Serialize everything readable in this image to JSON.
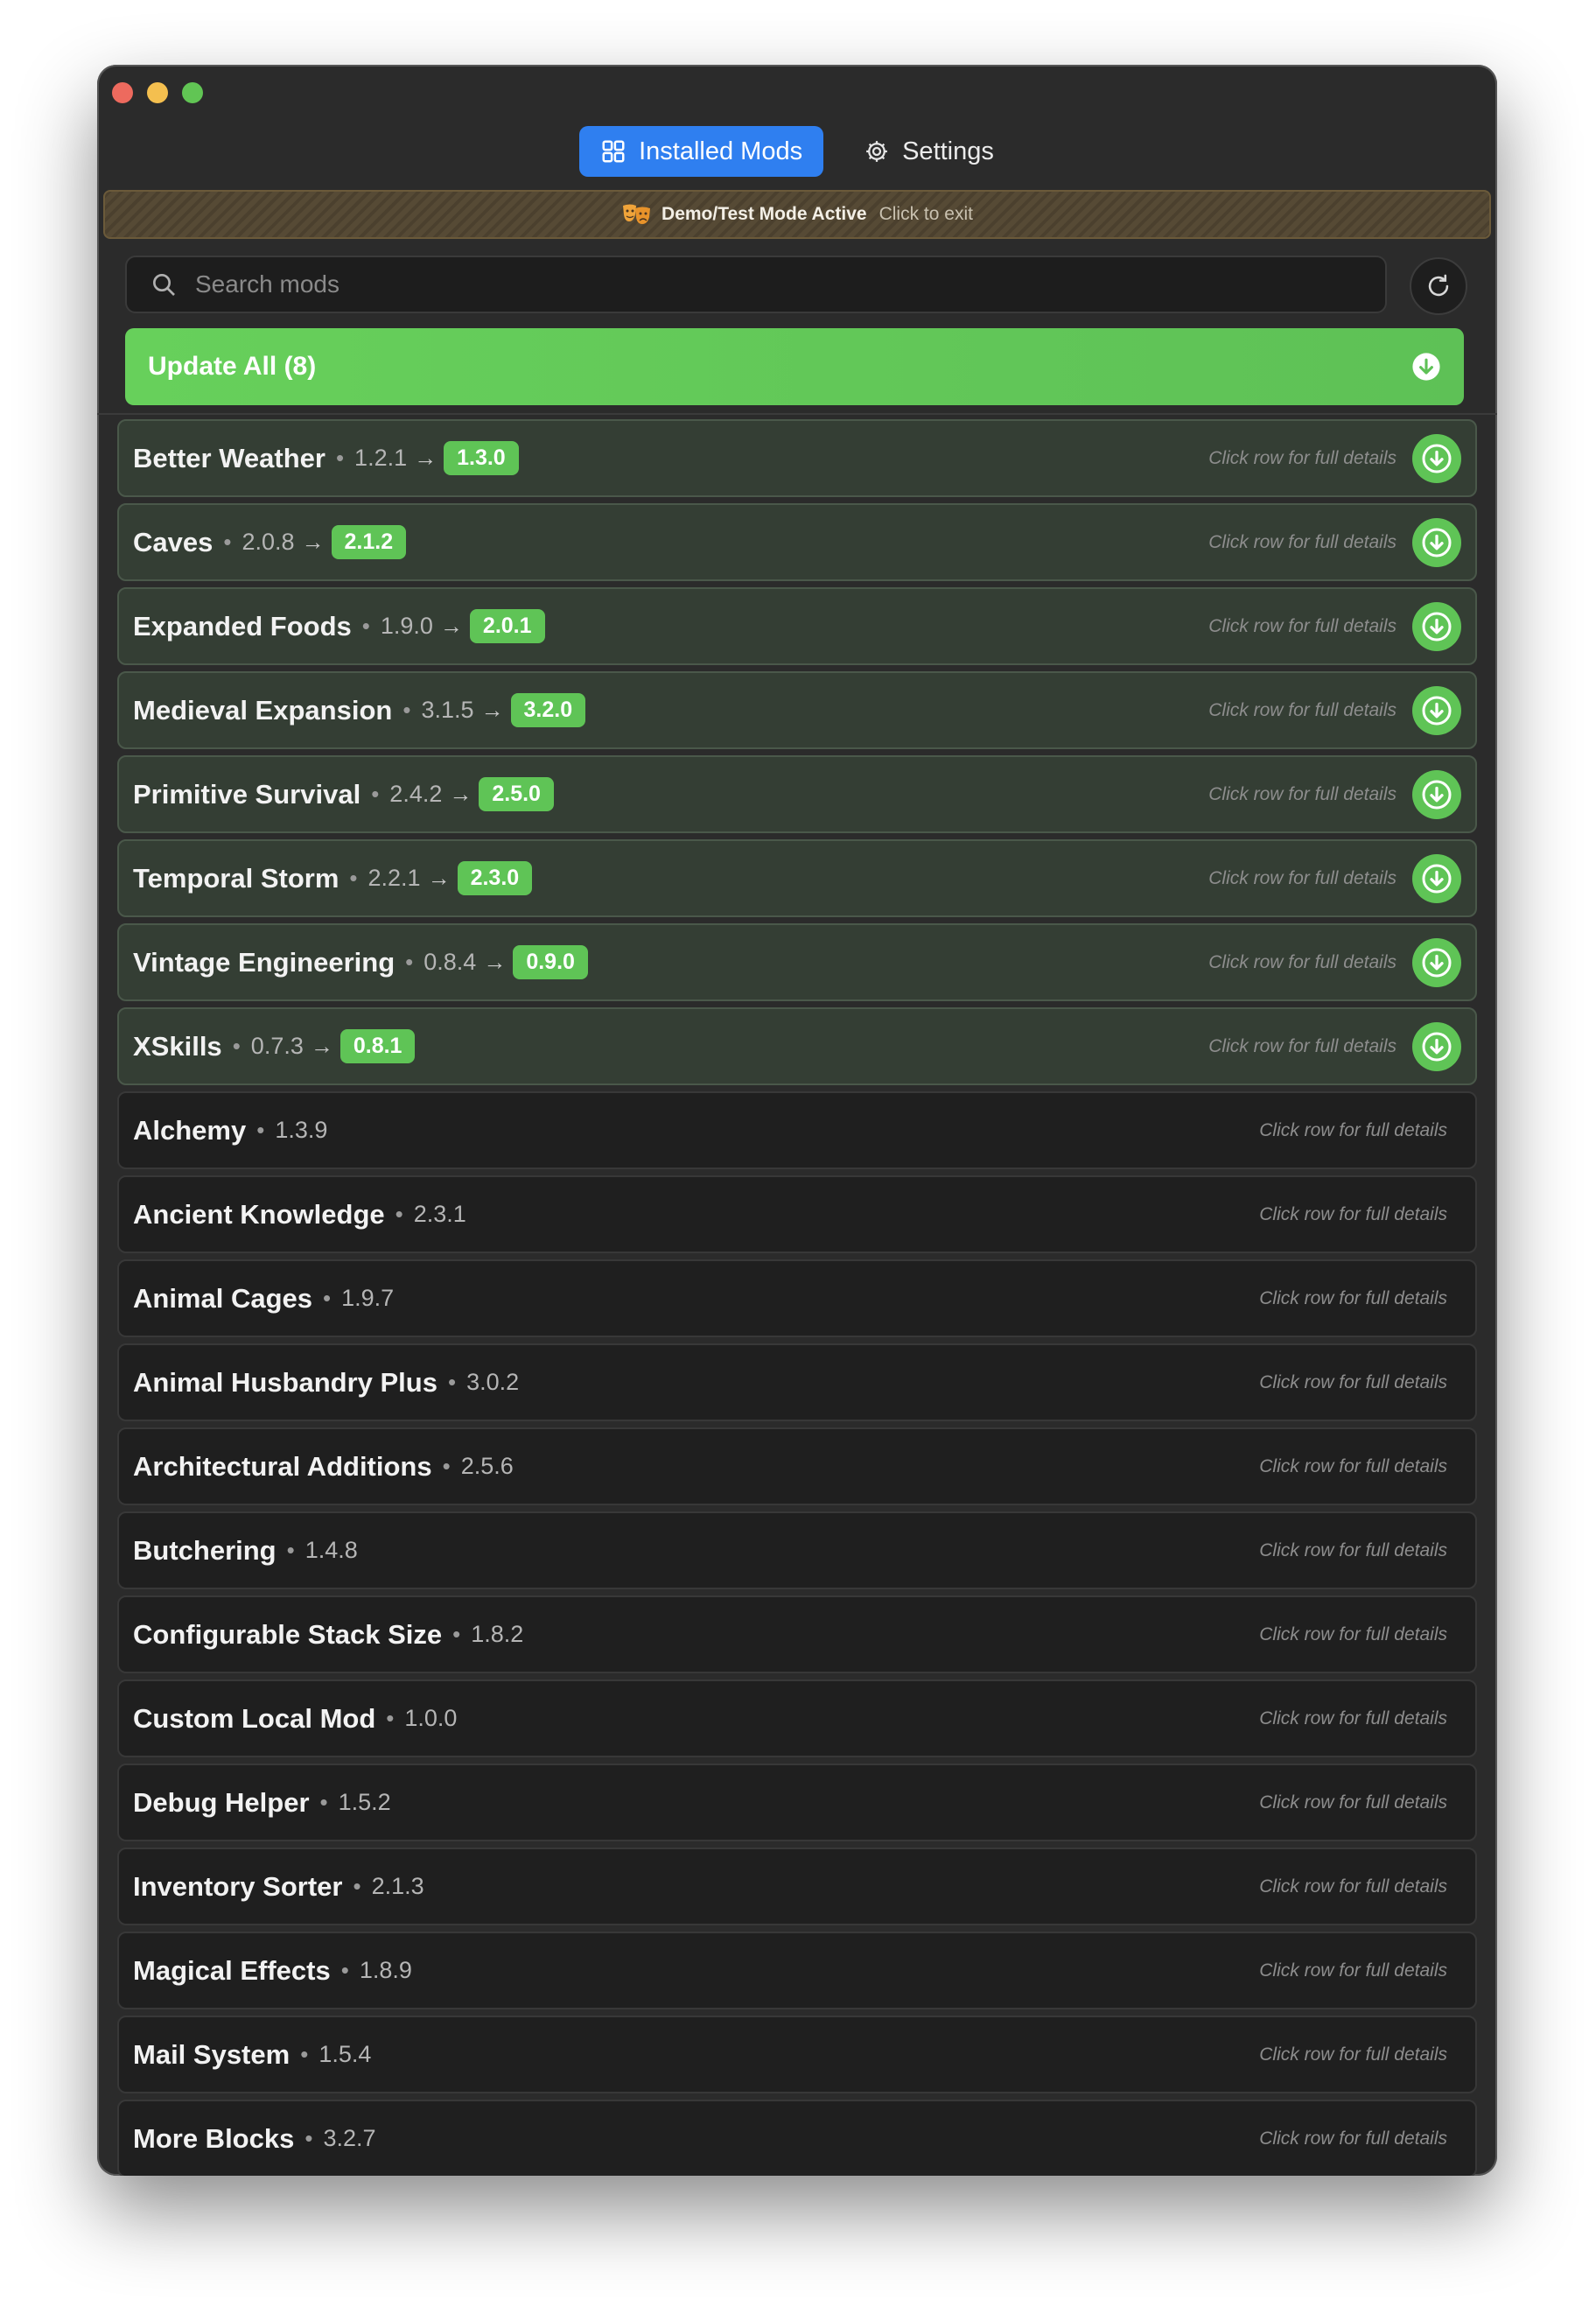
{
  "tabs": [
    {
      "label": "Installed Mods",
      "icon": "grid-icon",
      "active": true
    },
    {
      "label": "Settings",
      "icon": "gear-icon",
      "active": false
    }
  ],
  "banner": {
    "title": "Demo/Test Mode Active",
    "subtitle": "Click to exit",
    "icon": "theater-masks-icon"
  },
  "search": {
    "placeholder": "Search mods",
    "value": ""
  },
  "update_all": {
    "label": "Update All (8)"
  },
  "hint_text": "Click row for full details",
  "updates": [
    {
      "name": "Better Weather",
      "current": "1.2.1",
      "latest": "1.3.0"
    },
    {
      "name": "Caves",
      "current": "2.0.8",
      "latest": "2.1.2"
    },
    {
      "name": "Expanded Foods",
      "current": "1.9.0",
      "latest": "2.0.1"
    },
    {
      "name": "Medieval Expansion",
      "current": "3.1.5",
      "latest": "3.2.0"
    },
    {
      "name": "Primitive Survival",
      "current": "2.4.2",
      "latest": "2.5.0"
    },
    {
      "name": "Temporal Storm",
      "current": "2.2.1",
      "latest": "2.3.0"
    },
    {
      "name": "Vintage Engineering",
      "current": "0.8.4",
      "latest": "0.9.0"
    },
    {
      "name": "XSkills",
      "current": "0.7.3",
      "latest": "0.8.1"
    }
  ],
  "mods": [
    {
      "name": "Alchemy",
      "version": "1.3.9"
    },
    {
      "name": "Ancient Knowledge",
      "version": "2.3.1"
    },
    {
      "name": "Animal Cages",
      "version": "1.9.7"
    },
    {
      "name": "Animal Husbandry Plus",
      "version": "3.0.2"
    },
    {
      "name": "Architectural Additions",
      "version": "2.5.6"
    },
    {
      "name": "Butchering",
      "version": "1.4.8"
    },
    {
      "name": "Configurable Stack Size",
      "version": "1.8.2"
    },
    {
      "name": "Custom Local Mod",
      "version": "1.0.0"
    },
    {
      "name": "Debug Helper",
      "version": "1.5.2"
    },
    {
      "name": "Inventory Sorter",
      "version": "2.1.3"
    },
    {
      "name": "Magical Effects",
      "version": "1.8.9"
    },
    {
      "name": "Mail System",
      "version": "1.5.4"
    },
    {
      "name": "More Blocks",
      "version": "3.2.7"
    }
  ],
  "colors": {
    "accent": "#2f7ff0",
    "update_green": "#5fc456",
    "background": "#2b2b2b"
  }
}
